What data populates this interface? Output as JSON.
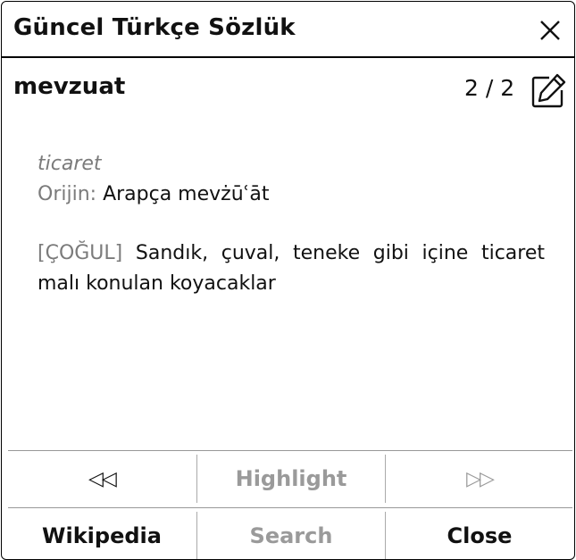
{
  "window": {
    "title": "Güncel Türkçe Sözlük"
  },
  "entry": {
    "headword": "mevzuat",
    "counter": "2 / 2",
    "domain": "ticaret",
    "origin_label": "Orijin:",
    "origin_value": "Arapça mevżūʿāt",
    "tag": "[ÇOĞUL]",
    "definition": "Sandık, çuval, teneke gibi içine ticaret malı konulan koyacaklar"
  },
  "buttons": {
    "prev_glyph": "◁◁",
    "highlight": "Highlight",
    "next_glyph": "▷▷",
    "wikipedia": "Wikipedia",
    "search": "Search",
    "close": "Close"
  },
  "icons": {
    "close": "close-icon",
    "edit": "pencil-edit-icon"
  }
}
